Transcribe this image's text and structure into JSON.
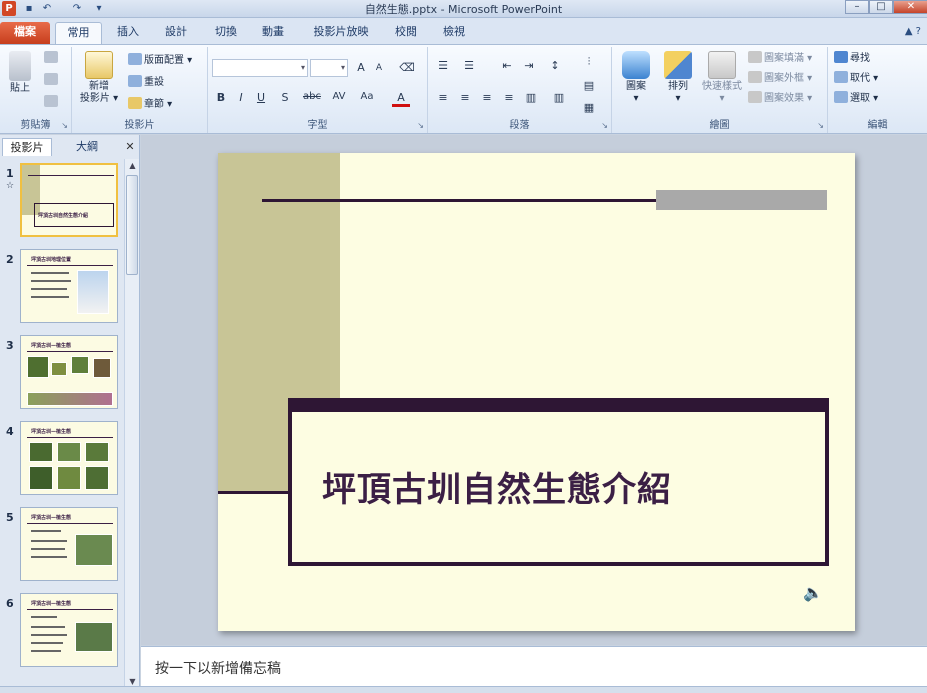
{
  "window": {
    "title": "自然生態.pptx - Microsoft PowerPoint",
    "app_icon": "P",
    "qat": [
      "save-icon",
      "undo-icon",
      "redo-icon",
      "customize-icon"
    ],
    "min": "–",
    "max": "□",
    "close": "✕"
  },
  "tabs": [
    {
      "label": "檔案",
      "kind": "file"
    },
    {
      "label": "常用",
      "active": true
    },
    {
      "label": "插入"
    },
    {
      "label": "設計"
    },
    {
      "label": "切換"
    },
    {
      "label": "動畫"
    },
    {
      "label": "投影片放映"
    },
    {
      "label": "校閱"
    },
    {
      "label": "檢視"
    }
  ],
  "ribbon": {
    "clipboard": {
      "group": "剪貼簿",
      "paste": "貼上"
    },
    "slides": {
      "group": "投影片",
      "new_slide_1": "新增",
      "new_slide_2": "投影片",
      "layout": "版面配置",
      "reset": "重設",
      "section": "章節"
    },
    "font": {
      "group": "字型",
      "bold": "B",
      "italic": "I",
      "underline": "U",
      "shadow": "S",
      "strike": "abc",
      "spacing": "AV",
      "case": "Aa",
      "color": "A",
      "grow": "A",
      "shrink": "A"
    },
    "paragraph": {
      "group": "段落"
    },
    "drawing": {
      "group": "繪圖",
      "shapes": "圖案",
      "arrange": "排列",
      "quick_styles": "快速樣式",
      "fill": "圖案填滿",
      "outline": "圖案外框",
      "effects": "圖案效果"
    },
    "editing": {
      "group": "編輯",
      "find": "尋找",
      "replace": "取代",
      "select": "選取"
    }
  },
  "panel": {
    "tab_slides": "投影片",
    "tab_outline": "大綱",
    "close": "✕",
    "thumbnails": [
      {
        "num": "1",
        "title": "坪頂古圳自然生態介紹"
      },
      {
        "num": "2",
        "title": "坪頂古圳地理位置"
      },
      {
        "num": "3",
        "title": "坪頂古圳—植生態"
      },
      {
        "num": "4",
        "title": "坪頂古圳—植生態"
      },
      {
        "num": "5",
        "title": "坪頂古圳—植生態"
      },
      {
        "num": "6",
        "title": "坪頂古圳—植生態"
      }
    ]
  },
  "slide": {
    "title": "坪頂古圳自然生態介紹",
    "colors": {
      "olive": "#c8c596",
      "dark": "#2e1634",
      "gray": "#a9a9a9",
      "bg": "#fdfde2"
    }
  },
  "notes": {
    "placeholder": "按一下以新增備忘稿"
  }
}
